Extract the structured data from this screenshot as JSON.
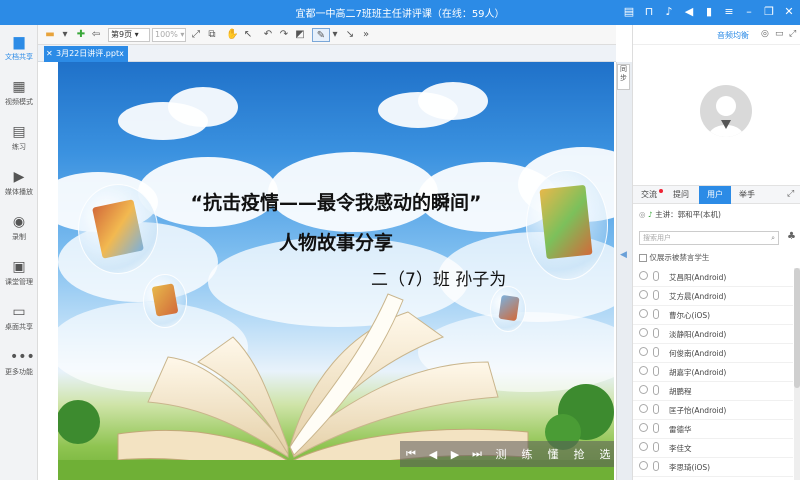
{
  "window": {
    "title": "宜都一中高二7班班主任讲评课（在线：59人）"
  },
  "sidebar": {
    "items": [
      {
        "label": "文档共享",
        "icon": "document-share-icon",
        "active": true
      },
      {
        "label": "视频模式",
        "icon": "video-mode-icon"
      },
      {
        "label": "练习",
        "icon": "exercise-icon"
      },
      {
        "label": "媒体播放",
        "icon": "media-play-icon"
      },
      {
        "label": "录制",
        "icon": "record-icon"
      },
      {
        "label": "课堂管理",
        "icon": "class-manage-icon"
      },
      {
        "label": "桌面共享",
        "icon": "desktop-share-icon"
      },
      {
        "label": "更多功能",
        "icon": "more-icon"
      }
    ]
  },
  "toolbar": {
    "page_select": "第9页",
    "zoom_select": "100%"
  },
  "document": {
    "tab_label": "3月22日讲评.pptx"
  },
  "slide": {
    "title": "“抗击疫情——最令我感动的瞬间”",
    "subtitle": "人物故事分享",
    "author": "二（7）班  孙子为",
    "nav_buttons": [
      "测",
      "练",
      "懂",
      "抢",
      "选"
    ]
  },
  "sync_label": "同步",
  "right_panel": {
    "audio_eq_label": "音频均衡",
    "tabs": [
      "交流",
      "提问",
      "用户",
      "举手"
    ],
    "active_tab": "用户",
    "lecturer": "主讲：郭和平(本机)",
    "search_placeholder": "搜索用户",
    "only_muted_label": "仅展示被禁言学生",
    "users": [
      "艾昌阳(Android)",
      "艾方晨(Android)",
      "曹尔心(iOS)",
      "淡静阳(Android)",
      "何俊南(Android)",
      "胡嘉宇(Android)",
      "胡鹏程",
      "匡子怡(Android)",
      "雷德华",
      "李佳文",
      "李思琦(iOS)"
    ]
  },
  "colors": {
    "accent": "#2c8be6"
  }
}
